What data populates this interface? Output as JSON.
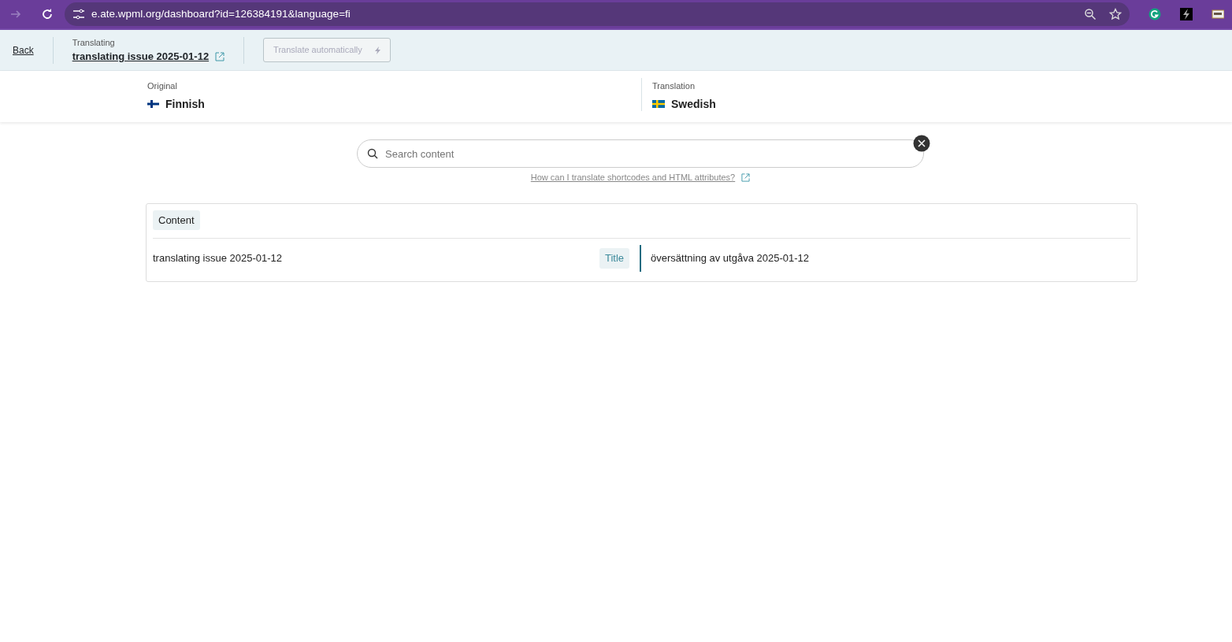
{
  "browser": {
    "url": "e.ate.wpml.org/dashboard?id=126384191&language=fi"
  },
  "toolbar": {
    "back": "Back",
    "translating_label": "Translating",
    "document_title": "translating issue 2025-01-12",
    "auto_button": {
      "label": "Translate automatically",
      "disabled": true
    }
  },
  "languages": {
    "original": {
      "label": "Original",
      "language": "Finnish"
    },
    "translation": {
      "label": "Translation",
      "language": "Swedish"
    }
  },
  "search": {
    "placeholder": "Search content",
    "help_link": "How can I translate shortcodes and HTML attributes?"
  },
  "content": {
    "section": "Content",
    "rows": [
      {
        "source": "translating issue 2025-01-12",
        "type_tag": "Title",
        "target": "översättning av utgåva 2025-01-12"
      }
    ]
  }
}
